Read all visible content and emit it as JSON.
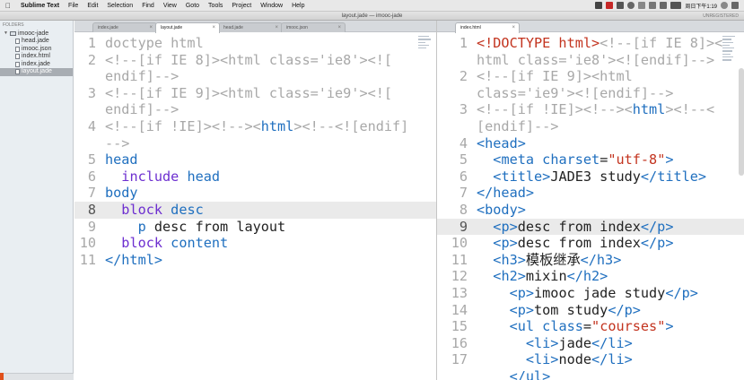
{
  "menubar": {
    "items": [
      "Sublime Text",
      "File",
      "Edit",
      "Selection",
      "Find",
      "View",
      "Goto",
      "Tools",
      "Project",
      "Window",
      "Help"
    ],
    "clock": "周日下午1:19"
  },
  "window": {
    "title": "layout.jade — imooc-jade",
    "unregistered": "UNREGISTERED"
  },
  "sidebar": {
    "header": "FOLDERS",
    "folder": "imooc-jade",
    "files": [
      "head.jade",
      "imooc.json",
      "index.html",
      "index.jade",
      "layout.jade"
    ],
    "selected_index": 4
  },
  "left_tabs": [
    "index.jade",
    "layout.jade",
    "head.jade",
    "imooc.json"
  ],
  "left_active_tab": 1,
  "right_tabs": [
    "index.html"
  ],
  "left_editor": {
    "current_line": "8",
    "lines": [
      {
        "n": "1",
        "parts": [
          [
            "cm",
            "doctype html"
          ]
        ]
      },
      {
        "n": "2",
        "parts": [
          [
            "cm",
            "<!--[if IE 8]><html class='ie8'><!["
          ]
        ]
      },
      {
        "n": "",
        "parts": [
          [
            "cm",
            "endif]-->"
          ]
        ]
      },
      {
        "n": "3",
        "parts": [
          [
            "cm",
            "<!--[if IE 9]><html class='ie9'><!["
          ]
        ]
      },
      {
        "n": "",
        "parts": [
          [
            "cm",
            "endif]-->"
          ]
        ]
      },
      {
        "n": "4",
        "parts": [
          [
            "cm",
            "<!--[if !IE]><!--><"
          ],
          [
            "tag",
            "html"
          ],
          [
            "cm",
            "><!--<![endif]"
          ]
        ]
      },
      {
        "n": "",
        "parts": [
          [
            "cm",
            "-->"
          ]
        ]
      },
      {
        "n": "5",
        "parts": [
          [
            "tag",
            "head"
          ]
        ]
      },
      {
        "n": "6",
        "parts": [
          [
            "pl",
            "  "
          ],
          [
            "kw",
            "include"
          ],
          [
            "pl",
            " "
          ],
          [
            "id",
            "head"
          ]
        ]
      },
      {
        "n": "7",
        "parts": [
          [
            "tag",
            "body"
          ]
        ]
      },
      {
        "n": "8",
        "parts": [
          [
            "pl",
            "  "
          ],
          [
            "kw",
            "block"
          ],
          [
            "pl",
            " "
          ],
          [
            "id",
            "desc"
          ]
        ]
      },
      {
        "n": "9",
        "parts": [
          [
            "pl",
            "    "
          ],
          [
            "tag",
            "p"
          ],
          [
            "pl",
            " desc from layout"
          ]
        ]
      },
      {
        "n": "10",
        "parts": [
          [
            "pl",
            "  "
          ],
          [
            "kw",
            "block"
          ],
          [
            "pl",
            " "
          ],
          [
            "id",
            "content"
          ]
        ]
      },
      {
        "n": "11",
        "parts": [
          [
            "tag",
            "</html>"
          ]
        ]
      }
    ]
  },
  "right_editor": {
    "current_line": "9",
    "lines": [
      {
        "n": "1",
        "parts": [
          [
            "str",
            "<!DOCTYPE html>"
          ],
          [
            "cm",
            "<!--[if IE 8]><"
          ]
        ]
      },
      {
        "n": "",
        "parts": [
          [
            "cm",
            "html class='ie8'><![endif]-->"
          ]
        ]
      },
      {
        "n": "2",
        "parts": [
          [
            "cm",
            "<!--[if IE 9]><html"
          ]
        ]
      },
      {
        "n": "",
        "parts": [
          [
            "cm",
            "class='ie9'><![endif]-->"
          ]
        ]
      },
      {
        "n": "3",
        "parts": [
          [
            "cm",
            "<!--[if !IE]><!--><"
          ],
          [
            "tag",
            "html"
          ],
          [
            "cm",
            "><!--<"
          ]
        ]
      },
      {
        "n": "",
        "parts": [
          [
            "cm",
            "[endif]-->"
          ]
        ]
      },
      {
        "n": "4",
        "parts": [
          [
            "tag",
            "<head>"
          ]
        ]
      },
      {
        "n": "5",
        "parts": [
          [
            "pl",
            "  "
          ],
          [
            "tag",
            "<meta"
          ],
          [
            "pl",
            " "
          ],
          [
            "att",
            "charset"
          ],
          [
            "pl",
            "="
          ],
          [
            "str",
            "\"utf-8\""
          ],
          [
            "tag",
            ">"
          ]
        ]
      },
      {
        "n": "6",
        "parts": [
          [
            "pl",
            "  "
          ],
          [
            "tag",
            "<title>"
          ],
          [
            "pl",
            "JADE3 study"
          ],
          [
            "tag",
            "</title>"
          ]
        ]
      },
      {
        "n": "7",
        "parts": [
          [
            "tag",
            "</head>"
          ]
        ]
      },
      {
        "n": "8",
        "parts": [
          [
            "tag",
            "<body>"
          ]
        ]
      },
      {
        "n": "9",
        "parts": [
          [
            "pl",
            "  "
          ],
          [
            "tag",
            "<p>"
          ],
          [
            "pl",
            "desc from index"
          ],
          [
            "tag",
            "</p>"
          ]
        ]
      },
      {
        "n": "10",
        "parts": [
          [
            "pl",
            "  "
          ],
          [
            "tag",
            "<p>"
          ],
          [
            "pl",
            "desc from index"
          ],
          [
            "tag",
            "</p>"
          ]
        ]
      },
      {
        "n": "11",
        "parts": [
          [
            "pl",
            "  "
          ],
          [
            "tag",
            "<h3>"
          ],
          [
            "pl",
            "模板继承"
          ],
          [
            "tag",
            "</h3>"
          ]
        ]
      },
      {
        "n": "12",
        "parts": [
          [
            "pl",
            "  "
          ],
          [
            "tag",
            "<h2>"
          ],
          [
            "pl",
            "mixin"
          ],
          [
            "tag",
            "</h2>"
          ]
        ]
      },
      {
        "n": "13",
        "parts": [
          [
            "pl",
            "    "
          ],
          [
            "tag",
            "<p>"
          ],
          [
            "pl",
            "imooc jade study"
          ],
          [
            "tag",
            "</p>"
          ]
        ]
      },
      {
        "n": "14",
        "parts": [
          [
            "pl",
            "    "
          ],
          [
            "tag",
            "<p>"
          ],
          [
            "pl",
            "tom study"
          ],
          [
            "tag",
            "</p>"
          ]
        ]
      },
      {
        "n": "15",
        "parts": [
          [
            "pl",
            "    "
          ],
          [
            "tag",
            "<ul"
          ],
          [
            "pl",
            " "
          ],
          [
            "att",
            "class"
          ],
          [
            "pl",
            "="
          ],
          [
            "str",
            "\"courses\""
          ],
          [
            "tag",
            ">"
          ]
        ]
      },
      {
        "n": "16",
        "parts": [
          [
            "pl",
            "      "
          ],
          [
            "tag",
            "<li>"
          ],
          [
            "pl",
            "jade"
          ],
          [
            "tag",
            "</li>"
          ]
        ]
      },
      {
        "n": "17",
        "parts": [
          [
            "pl",
            "      "
          ],
          [
            "tag",
            "<li>"
          ],
          [
            "pl",
            "node"
          ],
          [
            "tag",
            "</li>"
          ]
        ]
      },
      {
        "n": "",
        "parts": [
          [
            "pl",
            "    "
          ],
          [
            "tag",
            "</ul>"
          ]
        ]
      }
    ]
  }
}
